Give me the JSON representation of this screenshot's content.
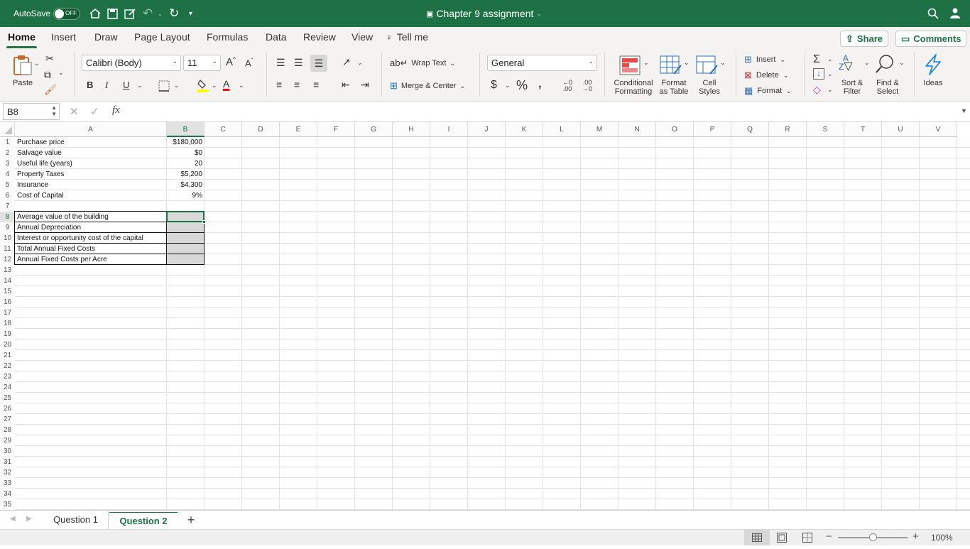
{
  "titlebar": {
    "autosave_label": "AutoSave",
    "autosave_state": "OFF",
    "doc_title": "Chapter 9 assignment",
    "qat_icons": [
      "home-icon",
      "save-icon",
      "edit-icon",
      "undo-icon",
      "redo-icon",
      "customize-icon"
    ]
  },
  "tabs": [
    "Home",
    "Insert",
    "Draw",
    "Page Layout",
    "Formulas",
    "Data",
    "Review",
    "View"
  ],
  "active_tab": "Home",
  "tell_me": "Tell me",
  "share_label": "Share",
  "comments_label": "Comments",
  "ribbon": {
    "paste_label": "Paste",
    "font_name": "Calibri (Body)",
    "font_size": "11",
    "bold": "B",
    "italic": "I",
    "underline": "U",
    "wrap_text": "Wrap Text",
    "merge_center": "Merge & Center",
    "number_format": "General",
    "currency_symbol": "$",
    "percent_symbol": "%",
    "comma_symbol": "❩",
    "conditional_formatting": [
      "Conditional",
      "Formatting"
    ],
    "format_as_table": [
      "Format",
      "as Table"
    ],
    "cell_styles": [
      "Cell",
      "Styles"
    ],
    "insert": "Insert",
    "delete": "Delete",
    "format": "Format",
    "sort_filter": [
      "Sort &",
      "Filter"
    ],
    "find_select": [
      "Find &",
      "Select"
    ],
    "ideas": "Ideas",
    "accent_color": "#217346",
    "highlight_color": "#ffff00",
    "font_color": "#ff0000"
  },
  "formula_bar": {
    "name_box": "B8",
    "fx": "fx",
    "formula": ""
  },
  "columns": [
    "A",
    "B",
    "C",
    "D",
    "E",
    "F",
    "G",
    "H",
    "I",
    "J",
    "K",
    "L",
    "M",
    "N",
    "O",
    "P",
    "Q",
    "R",
    "S",
    "T",
    "U",
    "V"
  ],
  "rows": [
    "1",
    "2",
    "3",
    "4",
    "5",
    "6",
    "7",
    "8",
    "9",
    "10",
    "11",
    "12",
    "13",
    "14",
    "15",
    "16",
    "17",
    "18",
    "19",
    "20",
    "21",
    "22",
    "23",
    "24",
    "25",
    "26",
    "27",
    "28",
    "29",
    "30",
    "31",
    "32",
    "33",
    "34",
    "35"
  ],
  "cells": {
    "A1": "Purchase price",
    "B1": "$180,000",
    "A2": "Salvage value",
    "B2": "$0",
    "A3": "Useful life (years)",
    "B3": "20",
    "A4": "Property Taxes",
    "B4": "$5,200",
    "A5": "Insurance",
    "B5": "$4,300",
    "A6": "Cost of Capital",
    "B6": "9%",
    "A8": "Average value of the building",
    "A9": "Annual Depreciation",
    "A10": "Interest or opportunity cost of the capital",
    "A11": "Total Annual Fixed Costs",
    "A12": "Annual Fixed Costs per Acre"
  },
  "selected_cell": "B8",
  "sheets": [
    "Question 1",
    "Question 2"
  ],
  "active_sheet": "Question 2",
  "add_sheet": "+",
  "zoom": "100%"
}
